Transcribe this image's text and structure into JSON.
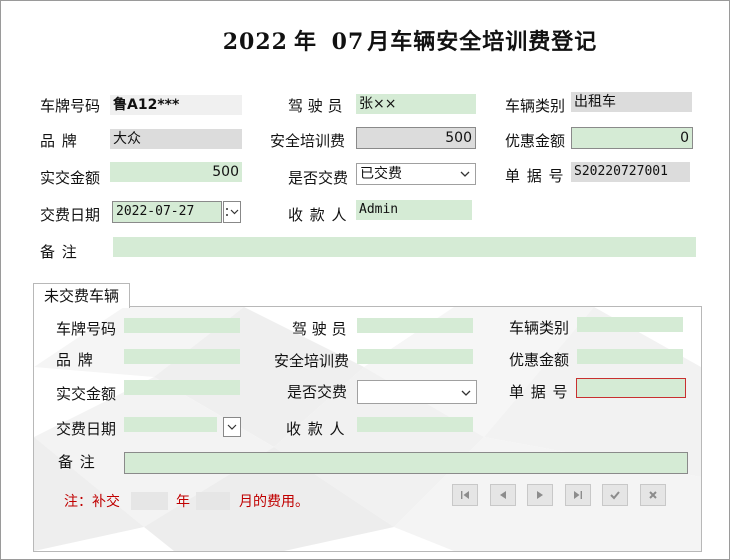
{
  "title": {
    "year": "2022",
    "year_suffix": "年",
    "month": "07",
    "rest": "月车辆安全培训费登记"
  },
  "form": {
    "plate_label": "车牌号码",
    "plate_value": "鲁A12***",
    "driver_label": "驾 驶 员",
    "driver_value": "张××",
    "vtype_label": "车辆类别",
    "vtype_value": "出租车",
    "brand_label": "品    牌",
    "brand_value": "大众",
    "fee_label": "安全培训费",
    "fee_value": "500",
    "discount_label": "优惠金额",
    "discount_value": "0",
    "paid_label": "实交金额",
    "paid_value": "500",
    "ispaid_label": "是否交费",
    "ispaid_value": "已交费",
    "receipt_label": "单 据 号",
    "receipt_value": "S20220727001",
    "date_label": "交费日期",
    "date_value": "2022-07-27",
    "payee_label": "收 款 人",
    "payee_value": "Admin",
    "remark_label": "备    注",
    "remark_value": ""
  },
  "tab": {
    "label": "未交费车辆"
  },
  "sub": {
    "plate_label": "车牌号码",
    "driver_label": "驾 驶 员",
    "vtype_label": "车辆类别",
    "brand_label": "品    牌",
    "fee_label": "安全培训费",
    "discount_label": "优惠金额",
    "paid_label": "实交金额",
    "ispaid_label": "是否交费",
    "receipt_label": "单 据 号",
    "date_label": "交费日期",
    "payee_label": "收 款 人",
    "remark_label": "备    注"
  },
  "note": {
    "prefix": "注：补交",
    "year_unit": "年",
    "suffix": "月的费用。"
  },
  "nav": {
    "first": "first-record-icon",
    "prev": "previous-record-icon",
    "next": "next-record-icon",
    "last": "last-record-icon",
    "save": "check-icon",
    "cancel": "cross-icon"
  }
}
